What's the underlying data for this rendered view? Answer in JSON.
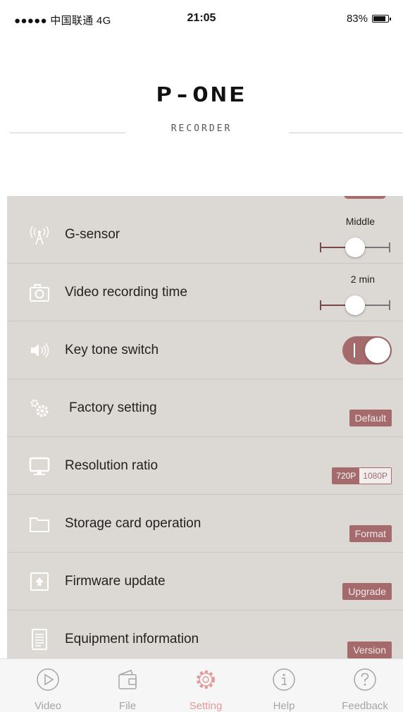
{
  "status": {
    "carrier": "●●●●● 中国联通  4G",
    "time": "21:05",
    "battery": "83%"
  },
  "logo": {
    "title": "P-ONE",
    "subtitle": "RECORDER"
  },
  "settings": {
    "g_sensor": {
      "label": "G-sensor",
      "value": "Middle",
      "level": 0.5
    },
    "video_recording_time": {
      "label": "Video recording time",
      "value": "2 min",
      "level": 0.5
    },
    "key_tone_switch": {
      "label": "Key tone switch",
      "state": "on"
    },
    "factory_setting": {
      "label": "Factory setting",
      "button": "Default"
    },
    "resolution_ratio": {
      "label": "Resolution ratio",
      "options": [
        "720P",
        "1080P"
      ],
      "selected": "720P"
    },
    "storage_card_operation": {
      "label": "Storage card operation",
      "button": "Format"
    },
    "firmware_update": {
      "label": "Firmware update",
      "button": "Upgrade"
    },
    "equipment_information": {
      "label": "Equipment information",
      "button": "Version"
    }
  },
  "tabs": [
    {
      "label": "Video",
      "icon": "play-circle-icon"
    },
    {
      "label": "File",
      "icon": "wallet-icon"
    },
    {
      "label": "Setting",
      "icon": "gear-icon",
      "active": true
    },
    {
      "label": "Help",
      "icon": "info-circle-icon"
    },
    {
      "label": "Feedback",
      "icon": "question-circle-icon"
    }
  ],
  "colors": {
    "accent": "#a46a6c",
    "panel": "#dcd8d3",
    "active_tab": "#e29a9a",
    "inactive_tab": "#a5a5a5"
  }
}
